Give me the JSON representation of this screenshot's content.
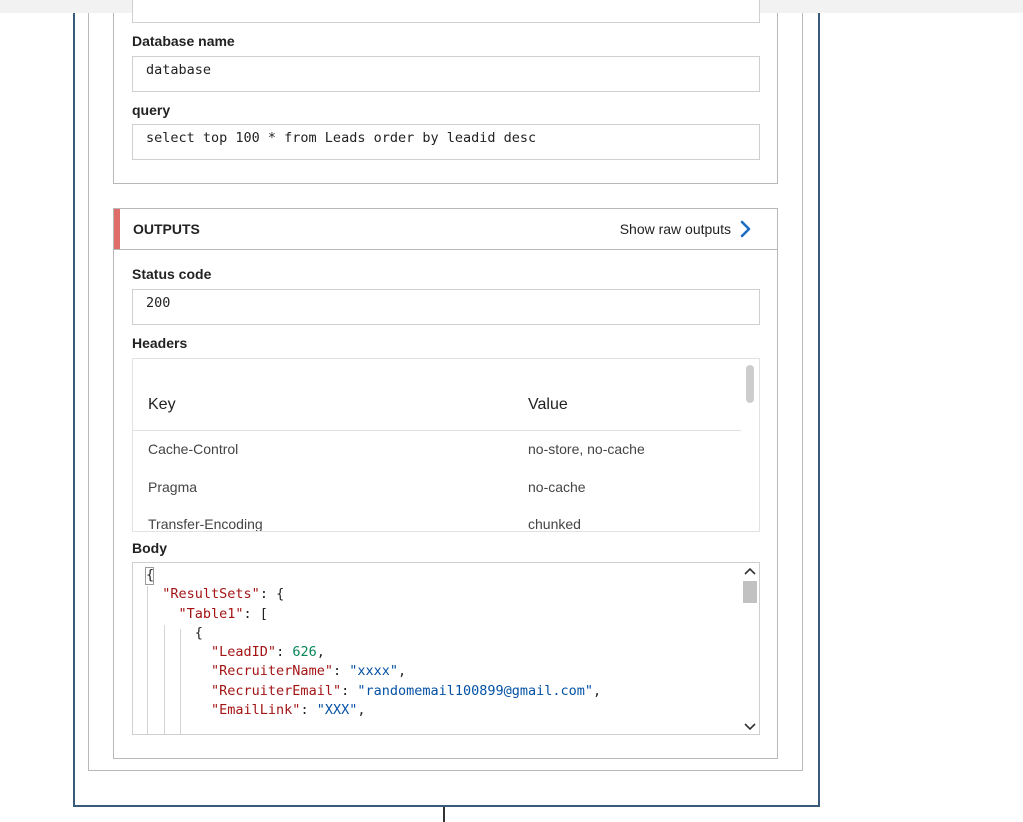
{
  "inputs": {
    "database_name_label": "Database name",
    "database_name_value": "database",
    "query_label": "query",
    "query_value": "select top 100 * from Leads order by leadid desc"
  },
  "outputs": {
    "title": "OUTPUTS",
    "show_raw_label": "Show raw outputs",
    "status_code_label": "Status code",
    "status_code_value": "200",
    "headers_label": "Headers",
    "headers_columns": {
      "key": "Key",
      "value": "Value"
    },
    "headers_rows": [
      {
        "key": "Cache-Control",
        "value": "no-store, no-cache"
      },
      {
        "key": "Pragma",
        "value": "no-cache"
      },
      {
        "key": "Transfer-Encoding",
        "value": "chunked"
      }
    ],
    "body_label": "Body"
  },
  "body_code": {
    "open_brace": "{",
    "resultsets_key": "\"ResultSets\"",
    "resultsets_punct": ": {",
    "table1_key": "\"Table1\"",
    "table1_punct": ": [",
    "row_open": "{",
    "leadid_key": "\"LeadID\"",
    "leadid_value": "626",
    "recruitername_key": "\"RecruiterName\"",
    "recruitername_value": "\"xxxx\"",
    "recruiteremail_key": "\"RecruiterEmail\"",
    "recruiteremail_value": "\"randomemail100899@gmail.com\"",
    "emaillink_key": "\"EmailLink\"",
    "emaillink_value": "\"XXX\""
  },
  "colors": {
    "outputs_accent": "#d9534f",
    "chevron": "#1b6ec2",
    "json_key": "#a31515",
    "json_string": "#0451a5",
    "json_number": "#098658",
    "card_border": "#3a5a7c"
  },
  "icons": {
    "show_raw": "chevron-right-icon",
    "scroll_up": "chevron-up-icon",
    "scroll_down": "chevron-down-icon"
  }
}
